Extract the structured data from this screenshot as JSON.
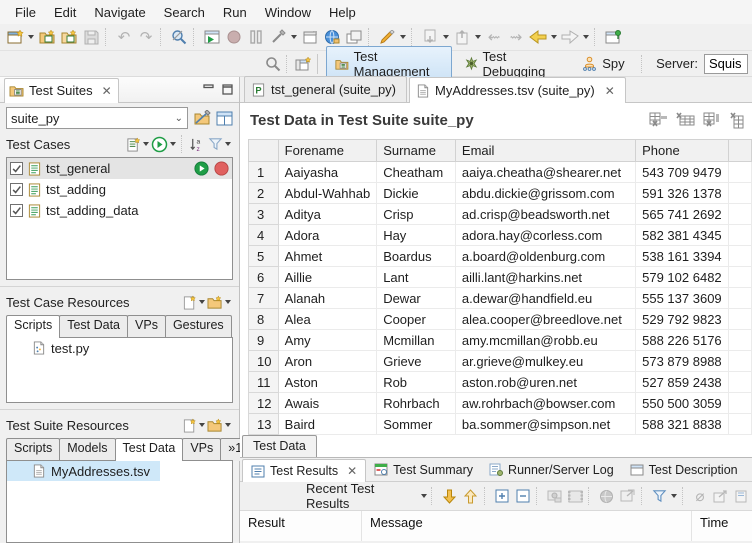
{
  "menu": {
    "items": [
      "File",
      "Edit",
      "Navigate",
      "Search",
      "Run",
      "Window",
      "Help"
    ]
  },
  "perspective_bar": {
    "buttons": [
      {
        "label": "Test Management",
        "active": true
      },
      {
        "label": "Test Debugging",
        "active": false
      },
      {
        "label": "Spy",
        "active": false
      }
    ],
    "server_label": "Server:",
    "server_value": "Squis"
  },
  "test_suites_view": {
    "tab_title": "Test Suites",
    "suite_selector_value": "suite_py",
    "test_cases_label": "Test Cases",
    "cases": [
      "tst_general",
      "tst_adding",
      "tst_adding_data"
    ],
    "selected_case": "tst_general"
  },
  "test_case_resources": {
    "title": "Test Case Resources",
    "tabs": [
      "Scripts",
      "Test Data",
      "VPs",
      "Gestures"
    ],
    "active_tab": "Scripts",
    "file": "test.py"
  },
  "test_suite_resources": {
    "title": "Test Suite Resources",
    "tabs": [
      "Scripts",
      "Models",
      "Test Data",
      "VPs",
      "»1"
    ],
    "active_tab": "Test Data",
    "file": "MyAddresses.tsv"
  },
  "editor": {
    "tab1": "tst_general (suite_py)",
    "tab2": "MyAddresses.tsv (suite_py)",
    "heading": "Test Data in Test Suite suite_py",
    "bottom_tab": "Test Data"
  },
  "data_table": {
    "columns": [
      "Forename",
      "Surname",
      "Email",
      "Phone"
    ],
    "rows": [
      [
        "Aaiyasha",
        "Cheatham",
        "aaiya.cheatha@shearer.net",
        "543 709 9479"
      ],
      [
        "Abdul-Wahhab",
        "Dickie",
        "abdu.dickie@grissom.com",
        "591 326 1378"
      ],
      [
        "Aditya",
        "Crisp",
        "ad.crisp@beadsworth.net",
        "565 741 2692"
      ],
      [
        "Adora",
        "Hay",
        "adora.hay@corless.com",
        "582 381 4345"
      ],
      [
        "Ahmet",
        "Boardus",
        "a.board@oldenburg.com",
        "538 161 3394"
      ],
      [
        "Aillie",
        "Lant",
        "ailli.lant@harkins.net",
        "579 102 6482"
      ],
      [
        "Alanah",
        "Dewar",
        "a.dewar@handfield.eu",
        "555 137 3609"
      ],
      [
        "Alea",
        "Cooper",
        "alea.cooper@breedlove.net",
        "529 792 9823"
      ],
      [
        "Amy",
        "Mcmillan",
        "amy.mcmillan@robb.eu",
        "588 226 5176"
      ],
      [
        "Aron",
        "Grieve",
        "ar.grieve@mulkey.eu",
        "573 879 8988"
      ],
      [
        "Aston",
        "Rob",
        "aston.rob@uren.net",
        "527 859 2438"
      ],
      [
        "Awais",
        "Rohrbach",
        "aw.rohrbach@bowser.com",
        "550 500 3059"
      ]
    ],
    "partial_row": [
      "Baird",
      "Sommer",
      "ba.sommer@simpson.net",
      "588 321 8838"
    ]
  },
  "results_panel": {
    "tabs": [
      "Test Results",
      "Test Summary",
      "Runner/Server Log",
      "Test Description"
    ],
    "active_tab": "Test Results",
    "recent_label": "Recent Test Results",
    "columns": [
      "Result",
      "Message",
      "Time"
    ]
  },
  "colors": {
    "selection_blue": "#cfe8f9",
    "perspective_blue": "#cde3f6",
    "play_green": "#1f9d46",
    "stop_red": "#e0605f",
    "accent_orange": "#e9a33c"
  }
}
